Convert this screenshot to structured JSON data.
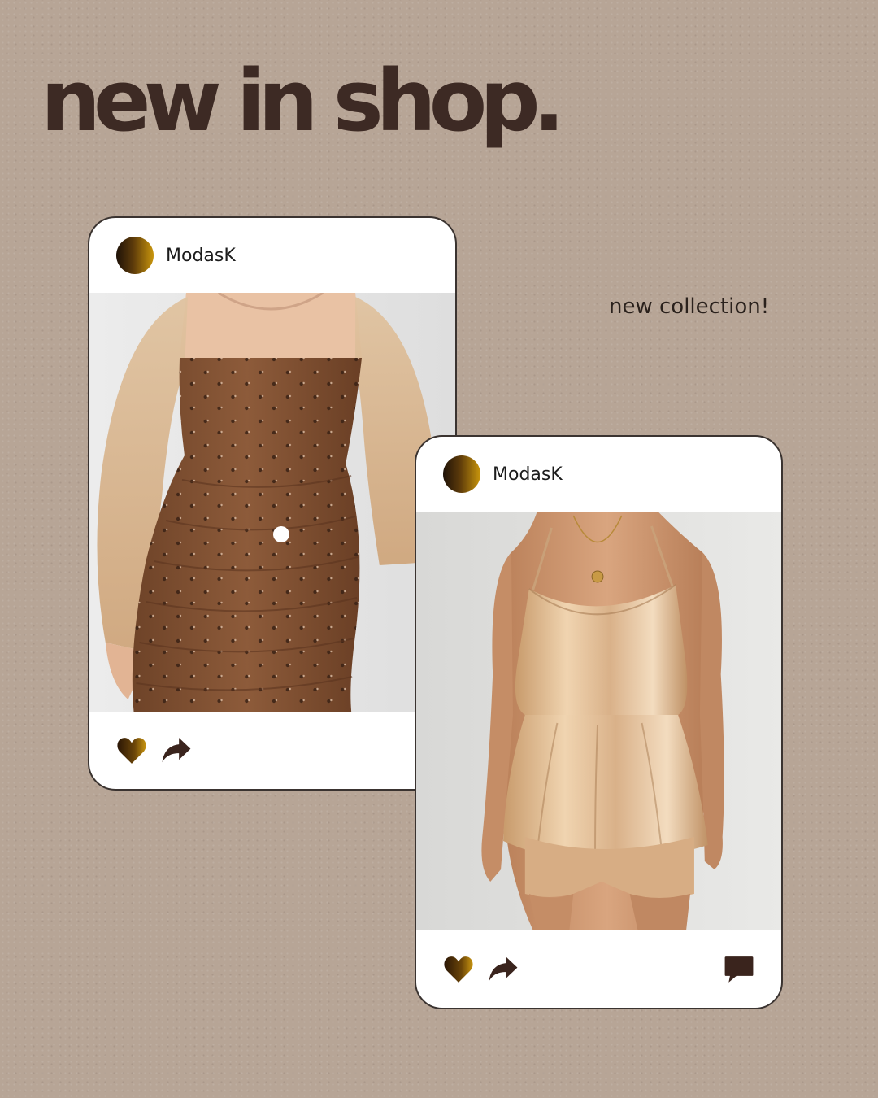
{
  "headline": "new in shop.",
  "tagline": "new collection!",
  "posts": [
    {
      "username": "ModasK",
      "image": "product photo: brown floral ruched mini dress with sheer beige balloon sleeves",
      "actions": [
        "heart-icon",
        "share-icon",
        "comment-icon"
      ]
    },
    {
      "username": "ModasK",
      "image": "product photo: champagne satin halter cami romper with flared peplum",
      "actions": [
        "heart-icon",
        "share-icon",
        "comment-icon"
      ]
    }
  ],
  "colors": {
    "background": "#b7a596",
    "headline": "#3d2a24",
    "icon": "#3a241d",
    "card_border": "#3a3330",
    "avatar_gradient": [
      "#1e1208",
      "#c9960c"
    ]
  }
}
